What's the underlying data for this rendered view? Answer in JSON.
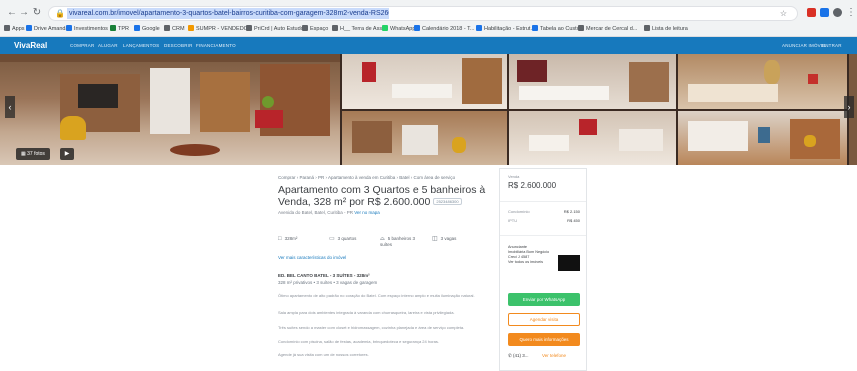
{
  "browser": {
    "url": "vivareal.com.br/imovel/apartamento-3-quartos-batel-bairros-curitiba-com-garagem-328m2-venda-RS2600000-id-2523486300",
    "bookmarks": [
      {
        "label": "Apps",
        "color": "#5f6368"
      },
      {
        "label": "Drive Amanda",
        "color": "#1a73e8"
      },
      {
        "label": "Investimentos",
        "color": "#1a73e8"
      },
      {
        "label": "TPR",
        "color": "#188038"
      },
      {
        "label": "Google",
        "color": "#1a73e8"
      },
      {
        "label": "CRM",
        "color": "#5f6368"
      },
      {
        "label": "SUMPR - VENDEDO...",
        "color": "#f29900"
      },
      {
        "label": "PriCrd | Auto Estudo",
        "color": "#5f6368"
      },
      {
        "label": "Espaço",
        "color": "#5f6368"
      },
      {
        "label": "H__ Terra de Ass...",
        "color": "#5f6368"
      },
      {
        "label": "WhatsApp",
        "color": "#25d366"
      },
      {
        "label": "Calendário 2018 - T...",
        "color": "#1a73e8"
      },
      {
        "label": "Habilitação - Estrut...",
        "color": "#1a73e8"
      },
      {
        "label": "Tabela ao Custo",
        "color": "#1a73e8"
      },
      {
        "label": "Mercar de Cercal d...",
        "color": "#5f6368"
      },
      {
        "label": "Lista de leitura",
        "color": "#5f6368"
      }
    ]
  },
  "site": {
    "logo": "VivaReal",
    "nav": [
      "COMPRAR",
      "ALUGAR",
      "LANÇAMENTOS",
      "DESCOBRIR",
      "FINANCIAMENTO"
    ],
    "nav_right": [
      "ANUNCIAR IMÓVEL",
      "ENTRAR"
    ]
  },
  "gallery": {
    "photo_count_label": "37 fotos",
    "video_label": "▶"
  },
  "listing": {
    "breadcrumb": "Comprar  ›  Paraná  ›  PR  ›  Apartamento à venda em Curitiba  ›  Batel  ›  Com área de serviço",
    "title": "Apartamento com 3 Quartos e 5 banheiros à Venda, 328 m² por R$ 2.600.000",
    "code": "2523486300",
    "address_line": "Avenida do Batel, Batel, Curitiba - PR",
    "address_link": "Ver no mapa",
    "features": [
      {
        "icon": "□",
        "label": "328m²"
      },
      {
        "icon": "▭",
        "label": "3 quartos"
      },
      {
        "icon": "⌓",
        "label": "5 banheiros 3 suítes"
      },
      {
        "icon": "◫",
        "label": "3 vagas"
      }
    ],
    "features_link": "Ver mais características do imóvel",
    "description_title": "ED. BEL CANTO BATEL - 3 SUÍTES - 328m²",
    "description_subtitle": "328 m² privativos • 3 suítes • 3 vagas de garagem",
    "description_lines": [
      "Ótimo apartamento de alto padrão no coração do Batel. Com espaço interno amplo e muita iluminação natural.",
      "Sala ampla para dois ambientes integrada à varanda com churrasqueira, lareira e vista privilegiada.",
      "Três suítes sendo a master com closet e hidromassagem, cozinha planejada e área de serviço completa.",
      "Condomínio com piscina, salão de festas, academia, brinquedoteca e segurança 24 horas.",
      "Agende já sua visita com um de nossos corretores."
    ]
  },
  "price_card": {
    "label": "Venda",
    "price": "R$ 2.600.000",
    "condo_label": "Condomínio",
    "condo_value": "R$ 2.150",
    "iptu_label": "IPTU",
    "iptu_value": "R$ 450",
    "advertiser_lines": [
      "Anunciante",
      "Imobiliária Bom Negócio Creci J 4587",
      "Ver todos os imóveis"
    ],
    "whatsapp_btn": "Enviar por WhatsApp",
    "visit_btn": "Agendar visita",
    "info_btn": "Quero mais informações",
    "phone": "(41) 3...",
    "phone_link": "Ver telefone"
  },
  "colors": {
    "brand_blue": "#1779bd",
    "whatsapp_green": "#3cc26b",
    "action_orange": "#f28a1e"
  }
}
